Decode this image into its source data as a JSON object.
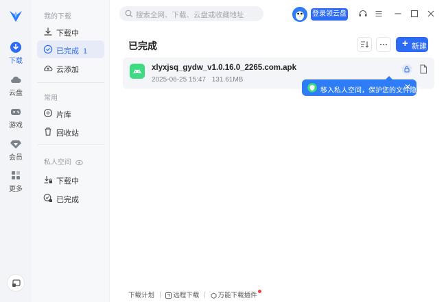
{
  "rail": {
    "items": [
      {
        "label": "下载",
        "icon": "download-icon"
      },
      {
        "label": "云盘",
        "icon": "cloud-icon"
      },
      {
        "label": "游戏",
        "icon": "gamepad-icon"
      },
      {
        "label": "会员",
        "icon": "diamond-icon"
      },
      {
        "label": "更多",
        "icon": "grid-icon"
      }
    ]
  },
  "sidebar": {
    "section_my_downloads": "我的下载",
    "downloading": "下载中",
    "completed": "已完成",
    "completed_count": "1",
    "cloud_add": "云添加",
    "section_common": "常用",
    "library": "片库",
    "recycle_bin": "回收站",
    "section_private": "私人空间",
    "private_downloading": "下载中",
    "private_completed": "已完成"
  },
  "header": {
    "search_placeholder": "搜索全网、下载、云盘或收藏地址",
    "login_button": "登录领云盘"
  },
  "main": {
    "title": "已完成",
    "new_button": "新建",
    "files": [
      {
        "name": "xlyxjsq_gydw_v1.0.16.0_2265.com.apk",
        "time": "2025-06-25 15:47",
        "size": "131.61MB"
      }
    ],
    "tooltip": "移入私人空间，保护您的文件隐私"
  },
  "footer": {
    "plan": "下载计划",
    "remote": "远程下载",
    "plugin": "万能下载插件"
  },
  "colors": {
    "accent": "#2e6bf5",
    "android_green": "#3ddc84",
    "badge_red": "#f53f3f"
  }
}
